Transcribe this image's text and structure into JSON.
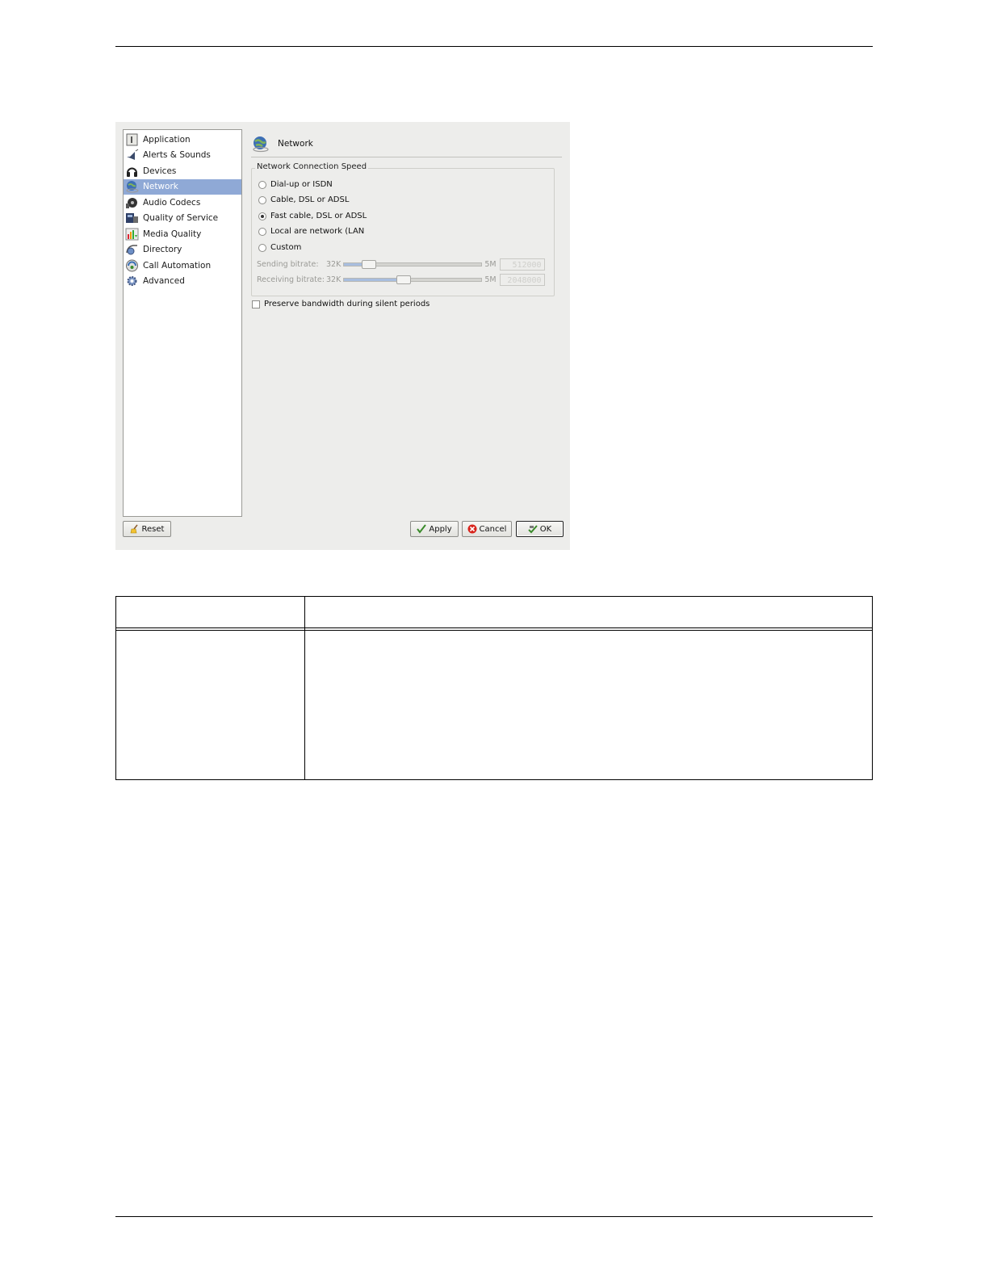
{
  "sidebar": {
    "items": [
      {
        "label": "Application",
        "icon": "application-icon",
        "selected": false
      },
      {
        "label": "Alerts & Sounds",
        "icon": "speaker-icon",
        "selected": false
      },
      {
        "label": "Devices",
        "icon": "headset-icon",
        "selected": false
      },
      {
        "label": "Network",
        "icon": "network-globe-icon",
        "selected": true
      },
      {
        "label": "Audio Codecs",
        "icon": "audio-codecs-icon",
        "selected": false
      },
      {
        "label": "Quality of Service",
        "icon": "qos-icon",
        "selected": false
      },
      {
        "label": "Media Quality",
        "icon": "media-quality-icon",
        "selected": false
      },
      {
        "label": "Directory",
        "icon": "directory-icon",
        "selected": false
      },
      {
        "label": "Call Automation",
        "icon": "call-automation-icon",
        "selected": false
      },
      {
        "label": "Advanced",
        "icon": "gear-icon",
        "selected": false
      }
    ]
  },
  "content": {
    "title": "Network",
    "group_title": "Network Connection Speed",
    "options": [
      {
        "label": "Dial-up or ISDN",
        "checked": false
      },
      {
        "label": "Cable, DSL or ADSL",
        "checked": false
      },
      {
        "label": "Fast cable, DSL or ADSL",
        "checked": true
      },
      {
        "label": "Local are network (LAN",
        "checked": false
      },
      {
        "label": "Custom",
        "checked": false
      }
    ],
    "sending": {
      "label": "Sending bitrate:",
      "min": "32K",
      "max": "5M",
      "value_fraction": 0.14,
      "display": "512000"
    },
    "receiving": {
      "label": "Receiving bitrate:",
      "min": "32K",
      "max": "5M",
      "value_fraction": 0.42,
      "display": "2048000"
    },
    "preserve_label": "Preserve bandwidth during silent periods"
  },
  "buttons": {
    "reset": "Reset",
    "apply": "Apply",
    "cancel": "Cancel",
    "ok": "OK"
  },
  "colors": {
    "selection": "#8fa9d6",
    "dialog_bg": "#ededeb"
  }
}
